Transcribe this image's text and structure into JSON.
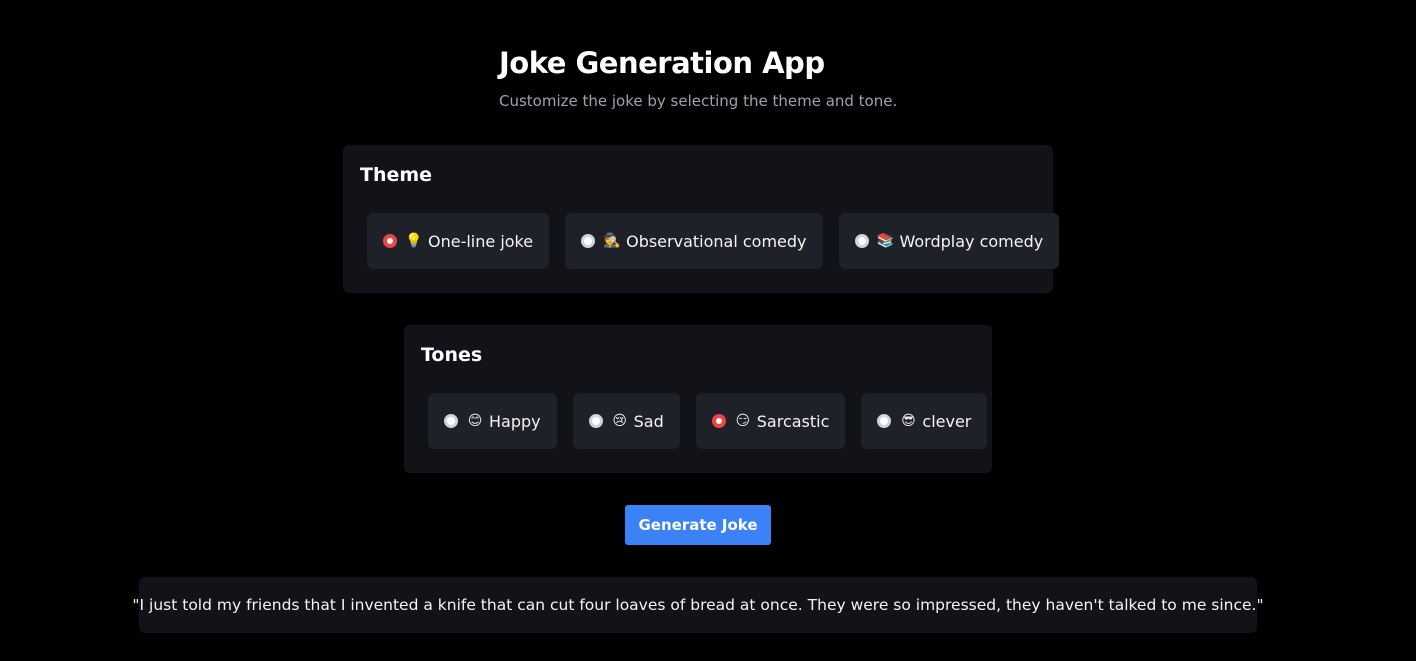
{
  "header": {
    "title": "Joke Generation App",
    "subtitle": "Customize the joke by selecting the theme and tone."
  },
  "theme": {
    "title": "Theme",
    "options": [
      {
        "emoji": "💡",
        "label": "One-line joke",
        "selected": true
      },
      {
        "emoji": "🕵️",
        "label": "Observational comedy",
        "selected": false
      },
      {
        "emoji": "📚",
        "label": "Wordplay comedy",
        "selected": false
      }
    ]
  },
  "tones": {
    "title": "Tones",
    "options": [
      {
        "emoji": "😊",
        "label": "Happy",
        "selected": false
      },
      {
        "emoji": "😢",
        "label": "Sad",
        "selected": false
      },
      {
        "emoji": "😏",
        "label": "Sarcastic",
        "selected": true
      },
      {
        "emoji": "😎",
        "label": "clever",
        "selected": false
      }
    ]
  },
  "generate_button": {
    "label": "Generate Joke"
  },
  "joke": {
    "text": "\"I just told my friends that I invented a knife that can cut four loaves of bread at once. They were so impressed, they haven't talked to me since.\""
  },
  "colors": {
    "background": "#000000",
    "panel": "#111318",
    "option_bg": "#1f2128",
    "accent": "#3b82f6",
    "radio_checked": "#ef4444"
  }
}
